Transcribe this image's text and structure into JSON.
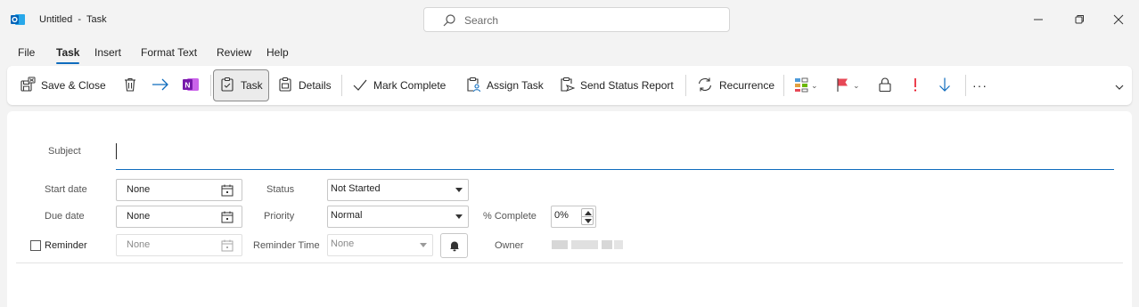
{
  "window": {
    "title": "Untitled  -  Task",
    "search_placeholder": "Search",
    "icons": [
      "outlook-icon",
      "search-icon",
      "minimize-icon",
      "restore-icon",
      "close-icon"
    ]
  },
  "menu": {
    "tabs": [
      "File",
      "Task",
      "Insert",
      "Format Text",
      "Review",
      "Help"
    ],
    "active": "Task"
  },
  "ribbon": {
    "save_close": "Save & Close",
    "task": "Task",
    "details": "Details",
    "mark_complete": "Mark Complete",
    "assign_task": "Assign Task",
    "send_status_report": "Send Status Report",
    "recurrence": "Recurrence",
    "more": "···",
    "icons": [
      "save-close-icon",
      "delete-icon",
      "forward-icon",
      "onenote-icon",
      "task-icon",
      "details-icon",
      "checkmark-icon",
      "assign-task-icon",
      "send-status-icon",
      "recurrence-icon",
      "categorize-icon",
      "flag-icon",
      "private-lock-icon",
      "high-importance-icon",
      "low-importance-icon",
      "ribbon-expand-icon"
    ],
    "colors": {
      "accent": "#0f6cbd",
      "flag": "#e74856",
      "importance_high": "#e81123",
      "onenote": "#7719aa"
    }
  },
  "form": {
    "subject_label": "Subject",
    "subject_value": "",
    "start_date_label": "Start date",
    "start_date_value": "None",
    "due_date_label": "Due date",
    "due_date_value": "None",
    "reminder_label": "Reminder",
    "reminder_checked": false,
    "reminder_date_value": "None",
    "status_label": "Status",
    "status_value": "Not Started",
    "priority_label": "Priority",
    "priority_value": "Normal",
    "reminder_time_label": "Reminder Time",
    "reminder_time_value": "None",
    "percent_complete_label": "% Complete",
    "percent_complete_value": "0%",
    "owner_label": "Owner"
  }
}
